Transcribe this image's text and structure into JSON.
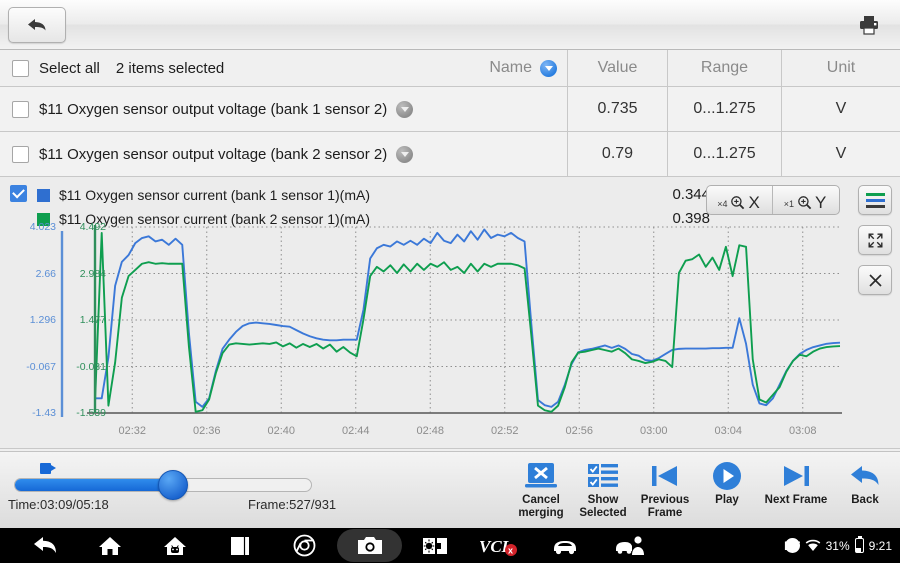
{
  "header": {
    "back_icon": "back-arrow-icon",
    "print_icon": "printer-icon"
  },
  "table": {
    "select_all_label": "Select all",
    "selected_count_label": "2 items selected",
    "columns": [
      "Name",
      "Value",
      "Range",
      "Unit"
    ],
    "sort_icon": "sort-descending-icon",
    "rows": [
      {
        "name": "$11 Oxygen sensor output voltage (bank 1 sensor 2)",
        "value": "0.735",
        "range": "0...1.275",
        "unit": "V",
        "checked": false
      },
      {
        "name": "$11 Oxygen sensor output voltage (bank 2 sensor 2)",
        "value": "0.79",
        "range": "0...1.275",
        "unit": "V",
        "checked": false
      }
    ]
  },
  "graph": {
    "checkbox_checked": true,
    "series_labels": [
      "$11 Oxygen sensor current (bank 1 sensor 1)(mA)",
      "$11 Oxygen sensor current (bank 2 sensor 1)(mA)"
    ],
    "series_values": [
      "0.344",
      "0.398"
    ],
    "zoom_x": {
      "factor": "×4",
      "axis": "X"
    },
    "zoom_y": {
      "factor": "×1",
      "axis": "Y"
    },
    "side_buttons": [
      "legend-lines-icon",
      "expand-fullscreen-icon",
      "close-icon"
    ]
  },
  "chart_data": {
    "type": "line",
    "title": "",
    "xlabel": "",
    "ylabel": "",
    "grid": true,
    "legend_position": "top-left",
    "x_ticks": [
      "02:32",
      "02:36",
      "02:40",
      "02:44",
      "02:48",
      "02:52",
      "02:56",
      "03:00",
      "03:04",
      "03:08"
    ],
    "axes": [
      {
        "name": "blue-axis",
        "color": "#5b8fd6",
        "ticks": [
          "4.023",
          "2.66",
          "1.296",
          "-0.067",
          "-1.43"
        ],
        "ylim": [
          -1.43,
          4.023
        ]
      },
      {
        "name": "green-axis",
        "color": "#2f8f5b",
        "ticks": [
          "4.492",
          "2.984",
          "1.477",
          "-0.031",
          "-1.539"
        ],
        "ylim": [
          -1.539,
          4.492
        ]
      }
    ],
    "series": [
      {
        "name": "$11 Oxygen sensor current (bank 1 sensor 1)(mA)",
        "color": "#3b78d8",
        "axis": "blue-axis",
        "values": [
          -1.0,
          -1.0,
          0.2,
          2.3,
          3.0,
          3.2,
          3.55,
          3.7,
          3.75,
          3.6,
          3.65,
          3.5,
          3.68,
          3.5,
          0.9,
          -1.1,
          -1.25,
          -1.0,
          -0.2,
          0.45,
          0.72,
          0.95,
          1.12,
          1.2,
          1.22,
          1.2,
          1.18,
          1.15,
          1.12,
          1.1,
          1.0,
          0.9,
          0.82,
          0.76,
          0.72,
          0.7,
          0.7,
          0.72,
          0.72,
          0.72,
          1.6,
          3.1,
          3.4,
          3.5,
          3.45,
          3.6,
          3.5,
          3.62,
          3.5,
          3.68,
          3.55,
          3.85,
          3.62,
          3.55,
          3.8,
          3.6,
          3.9,
          3.65,
          3.95,
          3.7,
          3.8,
          3.75,
          3.85,
          3.7,
          3.6,
          1.2,
          -1.05,
          -1.2,
          -1.25,
          -1.1,
          -0.6,
          0.0,
          0.35,
          0.42,
          0.45,
          0.5,
          0.55,
          0.48,
          0.55,
          0.45,
          0.3,
          0.25,
          0.12,
          0.1,
          0.18,
          0.3,
          0.42,
          0.45,
          0.46,
          0.46,
          0.46,
          0.46,
          0.47,
          0.47,
          0.48,
          0.48,
          1.35,
          0.6,
          -0.6,
          -1.15,
          -1.2,
          -1.0,
          -0.6,
          -0.2,
          0.1,
          0.3,
          0.42,
          0.5,
          0.55,
          0.6,
          0.62,
          0.63
        ]
      },
      {
        "name": "$11 Oxygen sensor current (bank 2 sensor 1)(mA)",
        "color": "#0e9e4f",
        "axis": "green-axis",
        "values": [
          -1.2,
          4.3,
          -1.3,
          0.1,
          2.2,
          2.9,
          3.1,
          3.3,
          3.35,
          3.3,
          3.32,
          3.3,
          3.3,
          3.3,
          0.6,
          -1.5,
          -1.45,
          -1.1,
          -0.25,
          0.4,
          0.68,
          0.72,
          0.7,
          0.68,
          0.7,
          0.72,
          0.7,
          0.75,
          0.62,
          0.72,
          0.58,
          0.7,
          0.6,
          0.7,
          0.55,
          0.68,
          0.45,
          0.6,
          0.42,
          0.3,
          1.5,
          2.9,
          3.2,
          3.05,
          3.25,
          3.0,
          3.28,
          3.05,
          3.3,
          3.1,
          3.3,
          3.2,
          3.35,
          3.1,
          3.2,
          3.0,
          3.3,
          3.05,
          3.3,
          3.2,
          3.3,
          3.3,
          3.3,
          3.25,
          3.15,
          1.0,
          -1.3,
          -1.45,
          -1.5,
          -1.3,
          -0.7,
          0.1,
          0.42,
          0.45,
          0.5,
          0.55,
          0.5,
          0.45,
          0.55,
          0.4,
          0.2,
          0.15,
          0.08,
          0.12,
          0.2,
          0.15,
          -0.05,
          3.0,
          3.4,
          3.45,
          3.6,
          3.2,
          3.5,
          3.1,
          3.85,
          2.9,
          3.9,
          3.85,
          0.2,
          -1.1,
          -1.2,
          -0.95,
          -0.7,
          -0.2,
          0.15,
          0.35,
          0.3,
          0.45,
          0.55,
          0.6,
          0.62,
          0.63
        ]
      }
    ]
  },
  "playback": {
    "time_label": "Time:03:09/05:18",
    "frame_label": "Frame:527/931",
    "slider_percent": 57,
    "buttons": [
      {
        "label_line1": "Cancel",
        "label_line2": "merging",
        "icon": "cancel-merging-icon"
      },
      {
        "label_line1": "Show",
        "label_line2": "Selected",
        "icon": "show-selected-icon"
      },
      {
        "label_line1": "Previous",
        "label_line2": "Frame",
        "icon": "previous-frame-icon"
      },
      {
        "label_line1": "Play",
        "label_line2": "",
        "icon": "play-icon"
      },
      {
        "label_line1": "Next Frame",
        "label_line2": "",
        "icon": "next-frame-icon"
      },
      {
        "label_line1": "Back",
        "label_line2": "",
        "icon": "back-icon"
      }
    ]
  },
  "navbar": {
    "icons": [
      "back-icon",
      "home-icon",
      "android-home-icon",
      "recents-icon",
      "chrome-icon",
      "camera-icon",
      "display-settings-icon",
      "vci-icon",
      "car-icon",
      "car-service-icon"
    ],
    "active_icon": "camera-icon",
    "status": {
      "bluetooth": "BT",
      "wifi_icon": "wifi-icon",
      "battery_percent": "31%",
      "battery_icon": "battery-icon",
      "clock": "9:21"
    }
  },
  "colors": {
    "accent_blue": "#3b78d8",
    "series_green": "#0e9e4f",
    "panel_bg": "#ececec"
  }
}
